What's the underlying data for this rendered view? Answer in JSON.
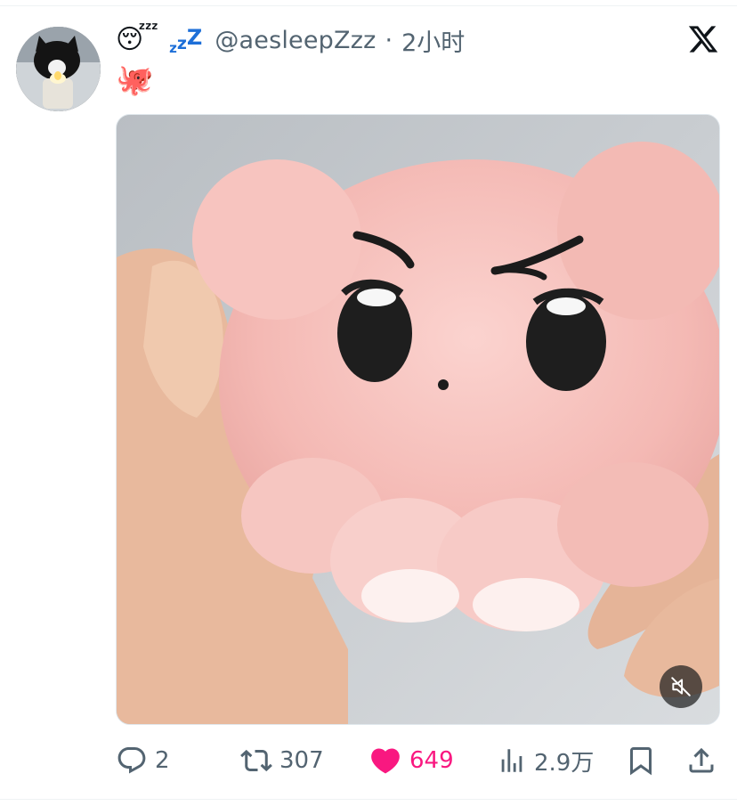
{
  "tweet": {
    "header": {
      "name_emoji": "😴",
      "zzz": [
        "z",
        "z",
        "Z"
      ],
      "handle": "@aesleepZzz",
      "separator": "·",
      "time": "2小时"
    },
    "text": "🐙",
    "media": {
      "kind": "video",
      "muted": true,
      "subject": "pink-octopus-plush"
    },
    "actions": {
      "replies": "2",
      "retweets": "307",
      "likes": "649",
      "liked": true,
      "views": "2.9万"
    }
  },
  "icons": {
    "brand": "x-logo-icon",
    "reply": "reply-icon",
    "retweet": "retweet-icon",
    "like": "heart-icon",
    "views": "views-icon",
    "bookmark": "bookmark-icon",
    "share": "share-icon",
    "mute": "mute-icon"
  },
  "colors": {
    "text": "#0f1419",
    "secondary": "#536471",
    "like": "#f91880",
    "zzz": "#1d6fd8"
  }
}
